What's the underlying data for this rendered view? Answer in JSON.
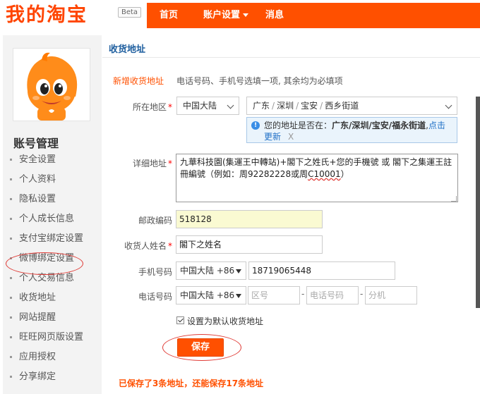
{
  "header": {
    "logo": "我的淘宝",
    "beta": "Beta",
    "nav": {
      "home": "首页",
      "account": "账户设置",
      "messages": "消息"
    }
  },
  "sidebar": {
    "title": "账号管理",
    "items": [
      "安全设置",
      "个人资料",
      "隐私设置",
      "个人成长信息",
      "支付宝绑定设置",
      "微博绑定设置",
      "个人交易信息",
      "收货地址",
      "网站提醒",
      "旺旺网页版设置",
      "应用授权",
      "分享绑定"
    ]
  },
  "main": {
    "title": "收货地址",
    "new_address": "新增收货地址",
    "hint": "电话号码、手机号选填一项, 其余均为必填项",
    "labels": {
      "region": "所在地区",
      "detail": "详细地址",
      "zip": "邮政编码",
      "name": "收货人姓名",
      "mobile": "手机号码",
      "phone": "电话号码"
    },
    "required_mark": "*",
    "country": "中国大陆",
    "region": [
      "广东",
      "深圳",
      "宝安",
      "西乡街道"
    ],
    "region_sep": "/",
    "notice": {
      "prefix": "您的地址是否在：",
      "address": "广东/深圳/宝安/福永街道",
      "link": "点击更新",
      "close": "X"
    },
    "detail_value_a": "九華科技園(集運王中轉站)+閣下之姓氏+您的手機號 或 閣下之集運王註冊編號（例如：周92282228或周",
    "detail_value_b": "C10001",
    "detail_value_c": "）",
    "zip_value": "518128",
    "name_value": "閣下之姓名",
    "mobile_country": "中国大陆 +86",
    "mobile_value": "18719065448",
    "phone_country": "中国大陆 +86",
    "area_placeholder": "区号",
    "tel_placeholder": "电话号码",
    "ext_placeholder": "分机",
    "dash": "-",
    "default_label": "设置为默认收货地址",
    "save": "保存",
    "saved_info": "已保存了3条地址，还能保存17条地址"
  },
  "colors": {
    "brand": "#ff5000",
    "title_blue": "#1f5f9f",
    "annotation_red": "#e03b36"
  }
}
